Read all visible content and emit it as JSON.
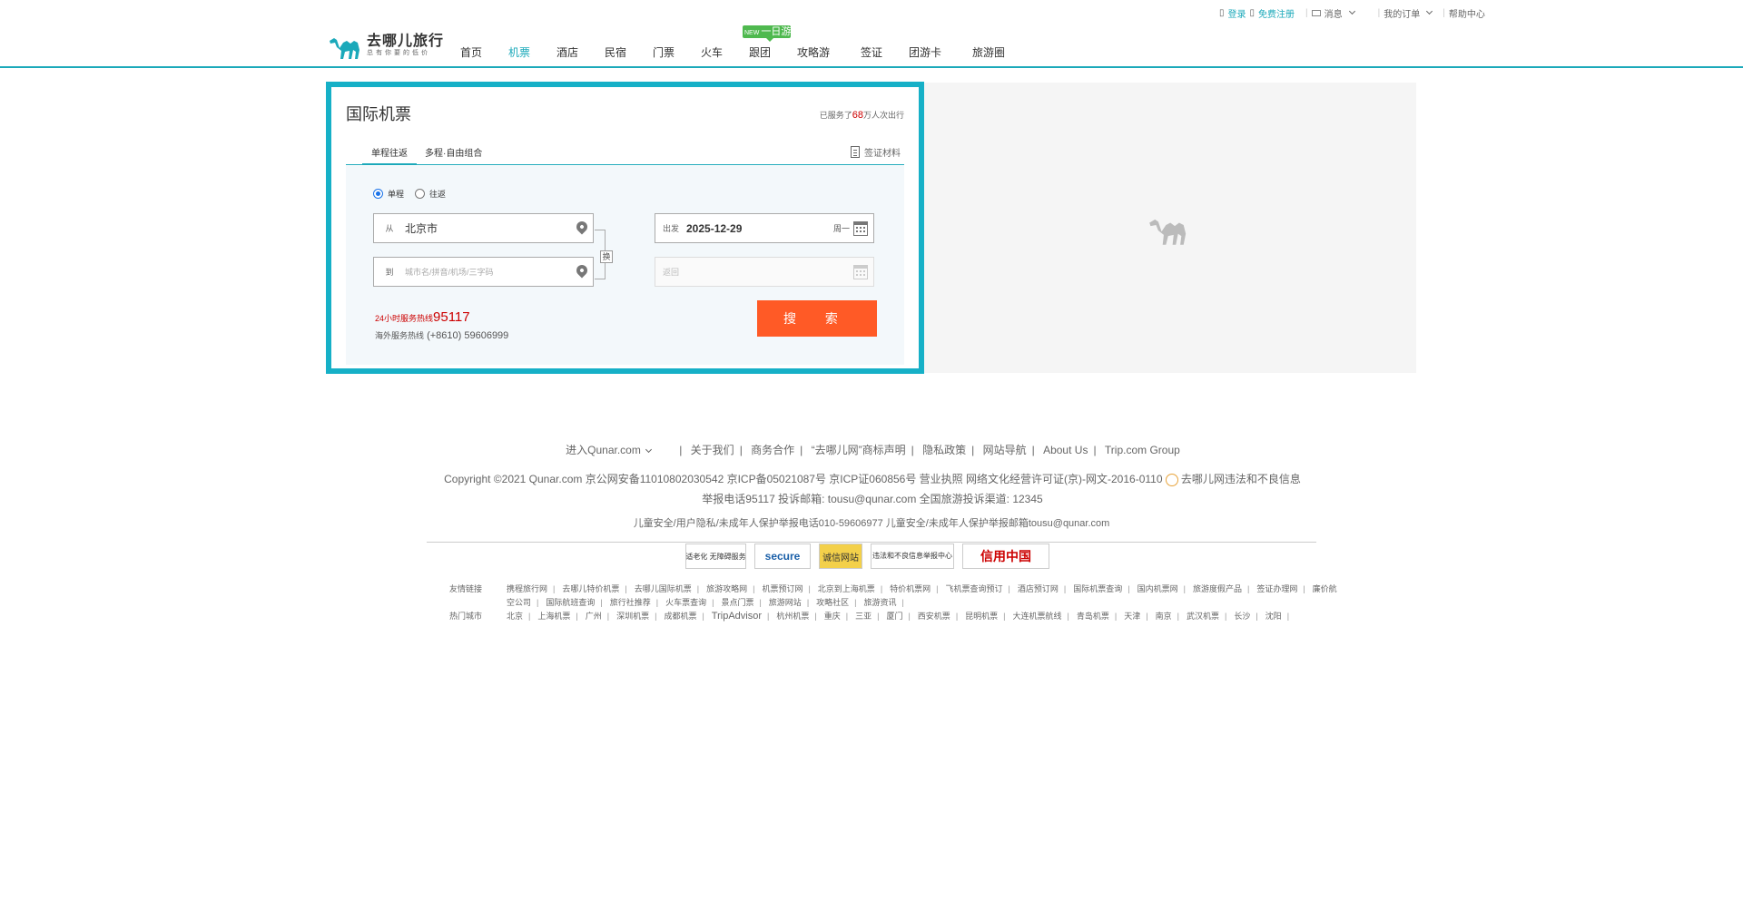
{
  "topbar": {
    "login": "登录",
    "register": "免费注册",
    "message": "消息",
    "my_orders": "我的订单",
    "help": "帮助中心"
  },
  "header": {
    "logo_text": "去哪儿旅行",
    "logo_slogan": "总有你要的低价",
    "nav": [
      {
        "label": "首页",
        "active": false
      },
      {
        "label": "机票",
        "active": true
      },
      {
        "label": "酒店",
        "active": false
      },
      {
        "label": "民宿",
        "active": false
      },
      {
        "label": "门票",
        "active": false
      },
      {
        "label": "火车",
        "active": false
      },
      {
        "label": "跟团",
        "active": false
      },
      {
        "label": "攻略游",
        "active": false
      },
      {
        "label": "签证",
        "active": false
      },
      {
        "label": "团游卡",
        "active": false
      },
      {
        "label": "旅游圈",
        "active": false
      }
    ],
    "new_badge_tag": "NEW",
    "new_badge_text": "一日游"
  },
  "search": {
    "title": "国际机票",
    "hotline_prefix": "已服务了",
    "hotline_count": "68",
    "hotline_suffix": "万人次出行",
    "tab_oneway_round": "单程往返",
    "tab_multi": "多程·自由组合",
    "tab_extra": "签证材料",
    "radio_oneway": "单程",
    "radio_round": "往返",
    "from_label": "从",
    "from_value": "北京市",
    "to_label": "到",
    "to_placeholder": "城市名/拼音/机场/三字码",
    "swap_label": "换",
    "depart_label": "出发",
    "depart_value": "2025-12-29",
    "depart_weekday": "周一",
    "return_placeholder": "返回",
    "hotline_24": "24小时服务热线",
    "hotline_number": "95117",
    "overseas_label": "海外服务热线",
    "overseas_number": "(+8610) 59606999",
    "search_button": "搜 索"
  },
  "footer": {
    "lang": "进入Qunar.com",
    "links": [
      "关于我们",
      "商务合作",
      "“去哪儿网”商标声明",
      "隐私政策",
      "网站导航",
      "About Us",
      "Trip.com Group"
    ],
    "copyright": "Copyright ©2021 Qunar.com  京公网安备11010802030542  京ICP备05021087号  京ICP证060856号  营业执照  网络文化经营许可证(京)-网文-2016-0110",
    "copyright2": "去哪儿网违法和不良信息举报电话95117  投诉邮箱: tousu@qunar.com  全国旅游投诉渠道: 12345",
    "complaint": "儿童安全/用户隐私/未成年人保护举报电话010-59606977  儿童安全/未成年人保护举报邮箱tousu@qunar.com",
    "badges": [
      "适老化 无障碍服务",
      "secure",
      "诚信网站",
      "违法和不良信息举报中心",
      "信用中国"
    ],
    "friend_head": "友情链接",
    "friend_links": [
      "携程旅行网",
      "去哪儿特价机票",
      "去哪儿国际机票",
      "旅游攻略网",
      "机票预订网",
      "北京到上海机票",
      "特价机票网",
      "飞机票查询预订",
      "酒店预订网",
      "国际机票查询",
      "国内机票网",
      "旅游度假产品",
      "签证办理网",
      "廉价航空公司",
      "国际航班查询",
      "旅行社推荐",
      "火车票查询",
      "景点门票",
      "旅游网站",
      "攻略社区",
      "旅游资讯"
    ],
    "hot_head": "热门城市",
    "hot_links": [
      "北京",
      "上海机票",
      "广州",
      "深圳机票",
      "成都机票",
      "TripAdvisor",
      "杭州机票",
      "重庆",
      "三亚",
      "厦门",
      "西安机票",
      "昆明机票",
      "大连机票航线",
      "青岛机票",
      "天津",
      "南京",
      "武汉机票",
      "长沙",
      "沈阳"
    ]
  },
  "colors": {
    "accent": "#1ba9ba",
    "card_border": "#16b0c7",
    "search_button": "#ff5a26",
    "hotline": "#cc0000"
  }
}
